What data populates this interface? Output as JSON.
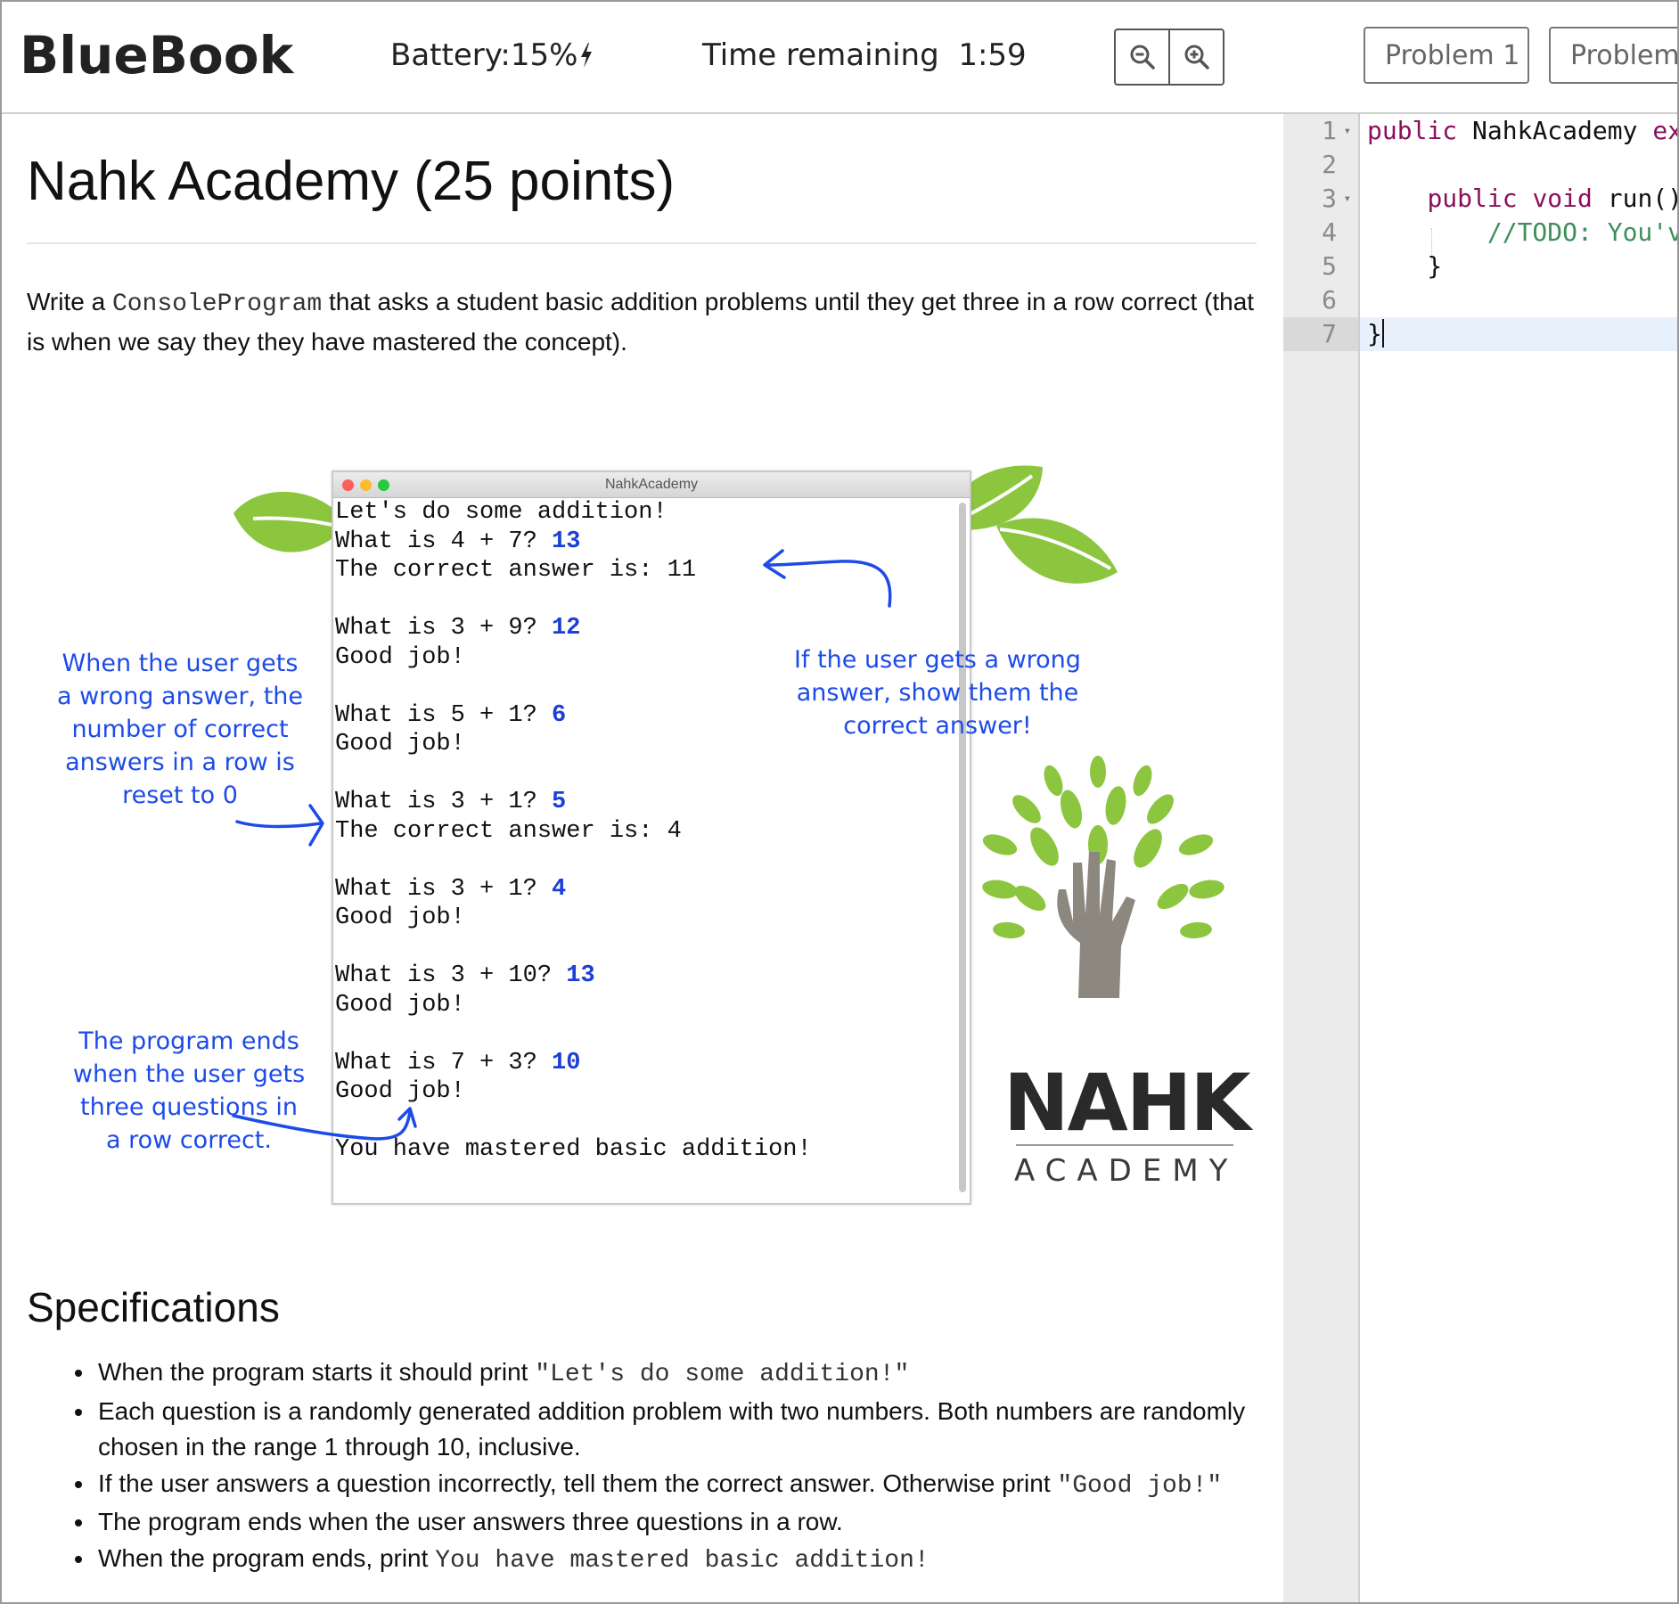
{
  "header": {
    "brand": "BlueBook",
    "battery_label": "Battery:15%",
    "time_label": "Time remaining",
    "time_value": "1:59",
    "zoom_out_icon": "zoom-out-icon",
    "zoom_in_icon": "zoom-in-icon",
    "tabs": [
      {
        "label": "Problem 1"
      },
      {
        "label": "Problem"
      }
    ]
  },
  "problem": {
    "title": "Nahk Academy (25 points)",
    "intro_before": "Write a ",
    "intro_code": "ConsoleProgram",
    "intro_after": " that asks a student basic addition problems until they get three in a row correct (that is when we say they they have mastered the concept).",
    "figure": {
      "window_title": "NahkAcademy",
      "console": {
        "l1": "Let's do some addition!",
        "l2": "What is 4 + 7? ",
        "a2": "13",
        "l3": "The correct answer is: 11",
        "l5": "What is 3 + 9? ",
        "a5": "12",
        "l6": "Good job!",
        "l8": "What is 5 + 1? ",
        "a8": "6",
        "l9": "Good job!",
        "l11": "What is 3 + 1? ",
        "a11": "5",
        "l12": "The correct answer is: 4",
        "l14": "What is 3 + 1? ",
        "a14": "4",
        "l15": "Good job!",
        "l17": "What is 3 + 10? ",
        "a17": "13",
        "l18": "Good job!",
        "l20": "What is 7 + 3? ",
        "a20": "10",
        "l21": "Good job!",
        "l23": "You have mastered basic addition!"
      },
      "notes": {
        "reset_1": "When the user gets",
        "reset_2": "a wrong answer, the",
        "reset_3": "number of correct",
        "reset_4": "answers in a row is",
        "reset_5": "reset to 0",
        "wrong_1": "If the user gets a wrong",
        "wrong_2": "answer, show them the",
        "wrong_3": "correct answer!",
        "end_1": "The program ends",
        "end_2": "when the user gets",
        "end_3": "three questions in",
        "end_4": "a row correct."
      },
      "logo": {
        "name": "NAHK",
        "sub": "ACADEMY"
      }
    },
    "specs_title": "Specifications",
    "specs": [
      {
        "text": "When the program starts it should print ",
        "code": "\"Let's do some addition!\""
      },
      {
        "text": "Each question is a randomly generated addition problem with two numbers. Both numbers are randomly chosen in the range 1 through 10, inclusive.",
        "code": ""
      },
      {
        "text": "If the user answers a question incorrectly, tell them the correct answer. Otherwise print ",
        "code": "\"Good job!\""
      },
      {
        "text": "The program ends when the user answers three questions in a row.",
        "code": ""
      },
      {
        "text": "When the program ends, print ",
        "code": "You have mastered basic addition!"
      }
    ]
  },
  "editor": {
    "line_numbers": [
      "1",
      "2",
      "3",
      "4",
      "5",
      "6",
      "7"
    ],
    "lines": {
      "l1_kw": "public",
      "l1_rest": " NahkAcademy ",
      "l1_kw2": "ex",
      "l3_indent": "    ",
      "l3_kw": "public void",
      "l3_rest": " run()",
      "l4_indent": "        ",
      "l4_comment": "//TODO: You'v",
      "l5": "    }",
      "l7": "}"
    }
  },
  "colors": {
    "annotation_blue": "#1d4be8",
    "keyword": "#8a0f5c",
    "comment": "#3c8f5a",
    "leaf_green": "#8cc63f",
    "trunk_gray": "#8c8880"
  }
}
